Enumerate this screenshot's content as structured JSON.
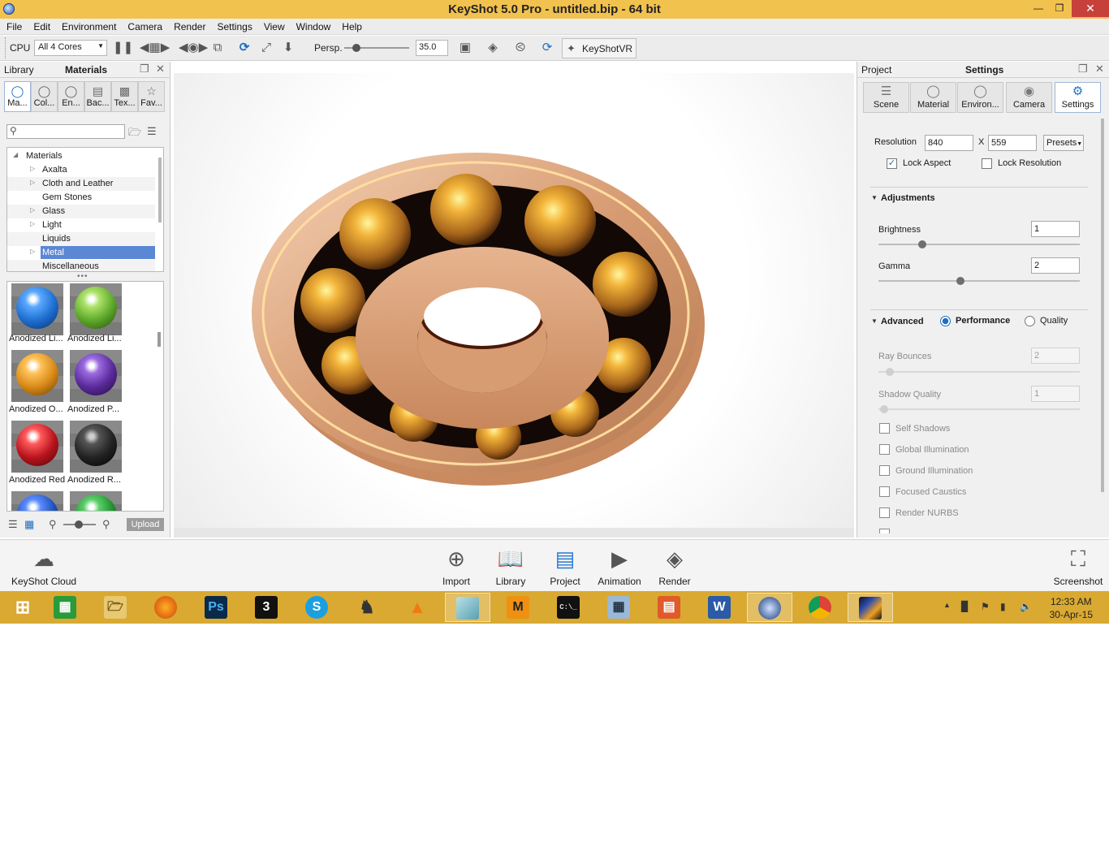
{
  "window": {
    "title": "KeyShot 5.0 Pro  - untitled.bip  - 64 bit",
    "controls": [
      "minimize",
      "restore",
      "close"
    ]
  },
  "menu": [
    "File",
    "Edit",
    "Environment",
    "Camera",
    "Render",
    "Settings",
    "View",
    "Window",
    "Help"
  ],
  "toolbar": {
    "cpu_label": "CPU",
    "cores_value": "All 4 Cores",
    "persp_label": "Persp.",
    "fov_value": "35.0",
    "vr_label": "KeyShotVR"
  },
  "left_panel": {
    "header_left": "Library",
    "header_title": "Materials",
    "tabs": [
      {
        "label": "Ma...",
        "icon": "material-icon"
      },
      {
        "label": "Col...",
        "icon": "color-icon"
      },
      {
        "label": "En...",
        "icon": "environment-icon"
      },
      {
        "label": "Bac...",
        "icon": "backplate-icon"
      },
      {
        "label": "Tex...",
        "icon": "texture-icon"
      },
      {
        "label": "Fav...",
        "icon": "favorite-icon"
      }
    ],
    "search_placeholder": "",
    "tree": [
      {
        "label": "Materials",
        "level": 0,
        "expander": "expanded"
      },
      {
        "label": "Axalta",
        "level": 1,
        "expander": "collapsed"
      },
      {
        "label": "Cloth and Leather",
        "level": 1,
        "expander": "collapsed"
      },
      {
        "label": "Gem Stones",
        "level": 1,
        "expander": "none"
      },
      {
        "label": "Glass",
        "level": 1,
        "expander": "collapsed"
      },
      {
        "label": "Light",
        "level": 1,
        "expander": "collapsed"
      },
      {
        "label": "Liquids",
        "level": 1,
        "expander": "none"
      },
      {
        "label": "Metal",
        "level": 1,
        "expander": "collapsed",
        "selected": true
      },
      {
        "label": "Miscellaneous",
        "level": 1,
        "expander": "none"
      }
    ],
    "thumbnails": [
      {
        "label": "Anodized Li...",
        "color": "#1f6fd1"
      },
      {
        "label": "Anodized Li...",
        "color": "#5da92a"
      },
      {
        "label": "Anodized O...",
        "color": "#d98a17"
      },
      {
        "label": "Anodized P...",
        "color": "#5a2a9a"
      },
      {
        "label": "Anodized Red",
        "color": "#b8131c"
      },
      {
        "label": "Anodized R...",
        "color": "#222222"
      },
      {
        "label": "",
        "color": "#1f4fb5"
      },
      {
        "label": "",
        "color": "#1f8f2a"
      }
    ],
    "upload_label": "Upload"
  },
  "right_panel": {
    "header_left": "Project",
    "header_title": "Settings",
    "tabs": [
      {
        "label": "Scene",
        "icon": "scene-icon"
      },
      {
        "label": "Material",
        "icon": "material-icon"
      },
      {
        "label": "Environ...",
        "icon": "environment-icon"
      },
      {
        "label": "Camera",
        "icon": "camera-icon"
      },
      {
        "label": "Settings",
        "icon": "gear-icon",
        "active": true
      }
    ],
    "resolution_label": "Resolution",
    "res_width": "840",
    "res_x": "X",
    "res_height": "559",
    "presets_label": "Presets",
    "lock_aspect_label": "Lock Aspect",
    "lock_aspect_checked": true,
    "lock_resolution_label": "Lock Resolution",
    "lock_resolution_checked": false,
    "adjustments_label": "Adjustments",
    "brightness_label": "Brightness",
    "brightness_value": "1",
    "gamma_label": "Gamma",
    "gamma_value": "2",
    "advanced_label": "Advanced",
    "performance_label": "Performance",
    "performance_selected": true,
    "quality_label": "Quality",
    "ray_bounces_label": "Ray Bounces",
    "ray_bounces_value": "2",
    "shadow_quality_label": "Shadow Quality",
    "shadow_quality_value": "1",
    "checkboxes": [
      "Self Shadows",
      "Global Illumination",
      "Ground Illumination",
      "Focused Caustics",
      "Render NURBS"
    ]
  },
  "bottom_bar": {
    "cloud_label": "KeyShot Cloud",
    "buttons": [
      {
        "label": "Import",
        "icon": "import-icon"
      },
      {
        "label": "Library",
        "icon": "library-icon",
        "active": true
      },
      {
        "label": "Project",
        "icon": "project-icon",
        "active": true
      },
      {
        "label": "Animation",
        "icon": "animation-icon"
      },
      {
        "label": "Render",
        "icon": "render-icon"
      }
    ],
    "screenshot_label": "Screenshot"
  },
  "taskbar": {
    "apps": [
      {
        "icon": "windows-start-icon"
      },
      {
        "icon": "store-icon"
      },
      {
        "icon": "file-explorer-icon"
      },
      {
        "icon": "firefox-icon"
      },
      {
        "icon": "photoshop-icon",
        "text": "Ps"
      },
      {
        "icon": "3dsmax-icon",
        "text": "3"
      },
      {
        "icon": "skype-icon",
        "text": "S"
      },
      {
        "icon": "chess-icon"
      },
      {
        "icon": "vlc-icon"
      },
      {
        "icon": "notes-app-icon"
      },
      {
        "icon": "mindjet-icon",
        "text": "M"
      },
      {
        "icon": "command-prompt-icon",
        "text": "C:\\_"
      },
      {
        "icon": "calculator-icon"
      },
      {
        "icon": "powerpoint-icon"
      },
      {
        "icon": "word-icon",
        "text": "W"
      },
      {
        "icon": "keyshot-icon"
      },
      {
        "icon": "chrome-icon"
      },
      {
        "icon": "paint-app-icon"
      }
    ],
    "time": "12:33 AM",
    "date": "30-Apr-15"
  }
}
